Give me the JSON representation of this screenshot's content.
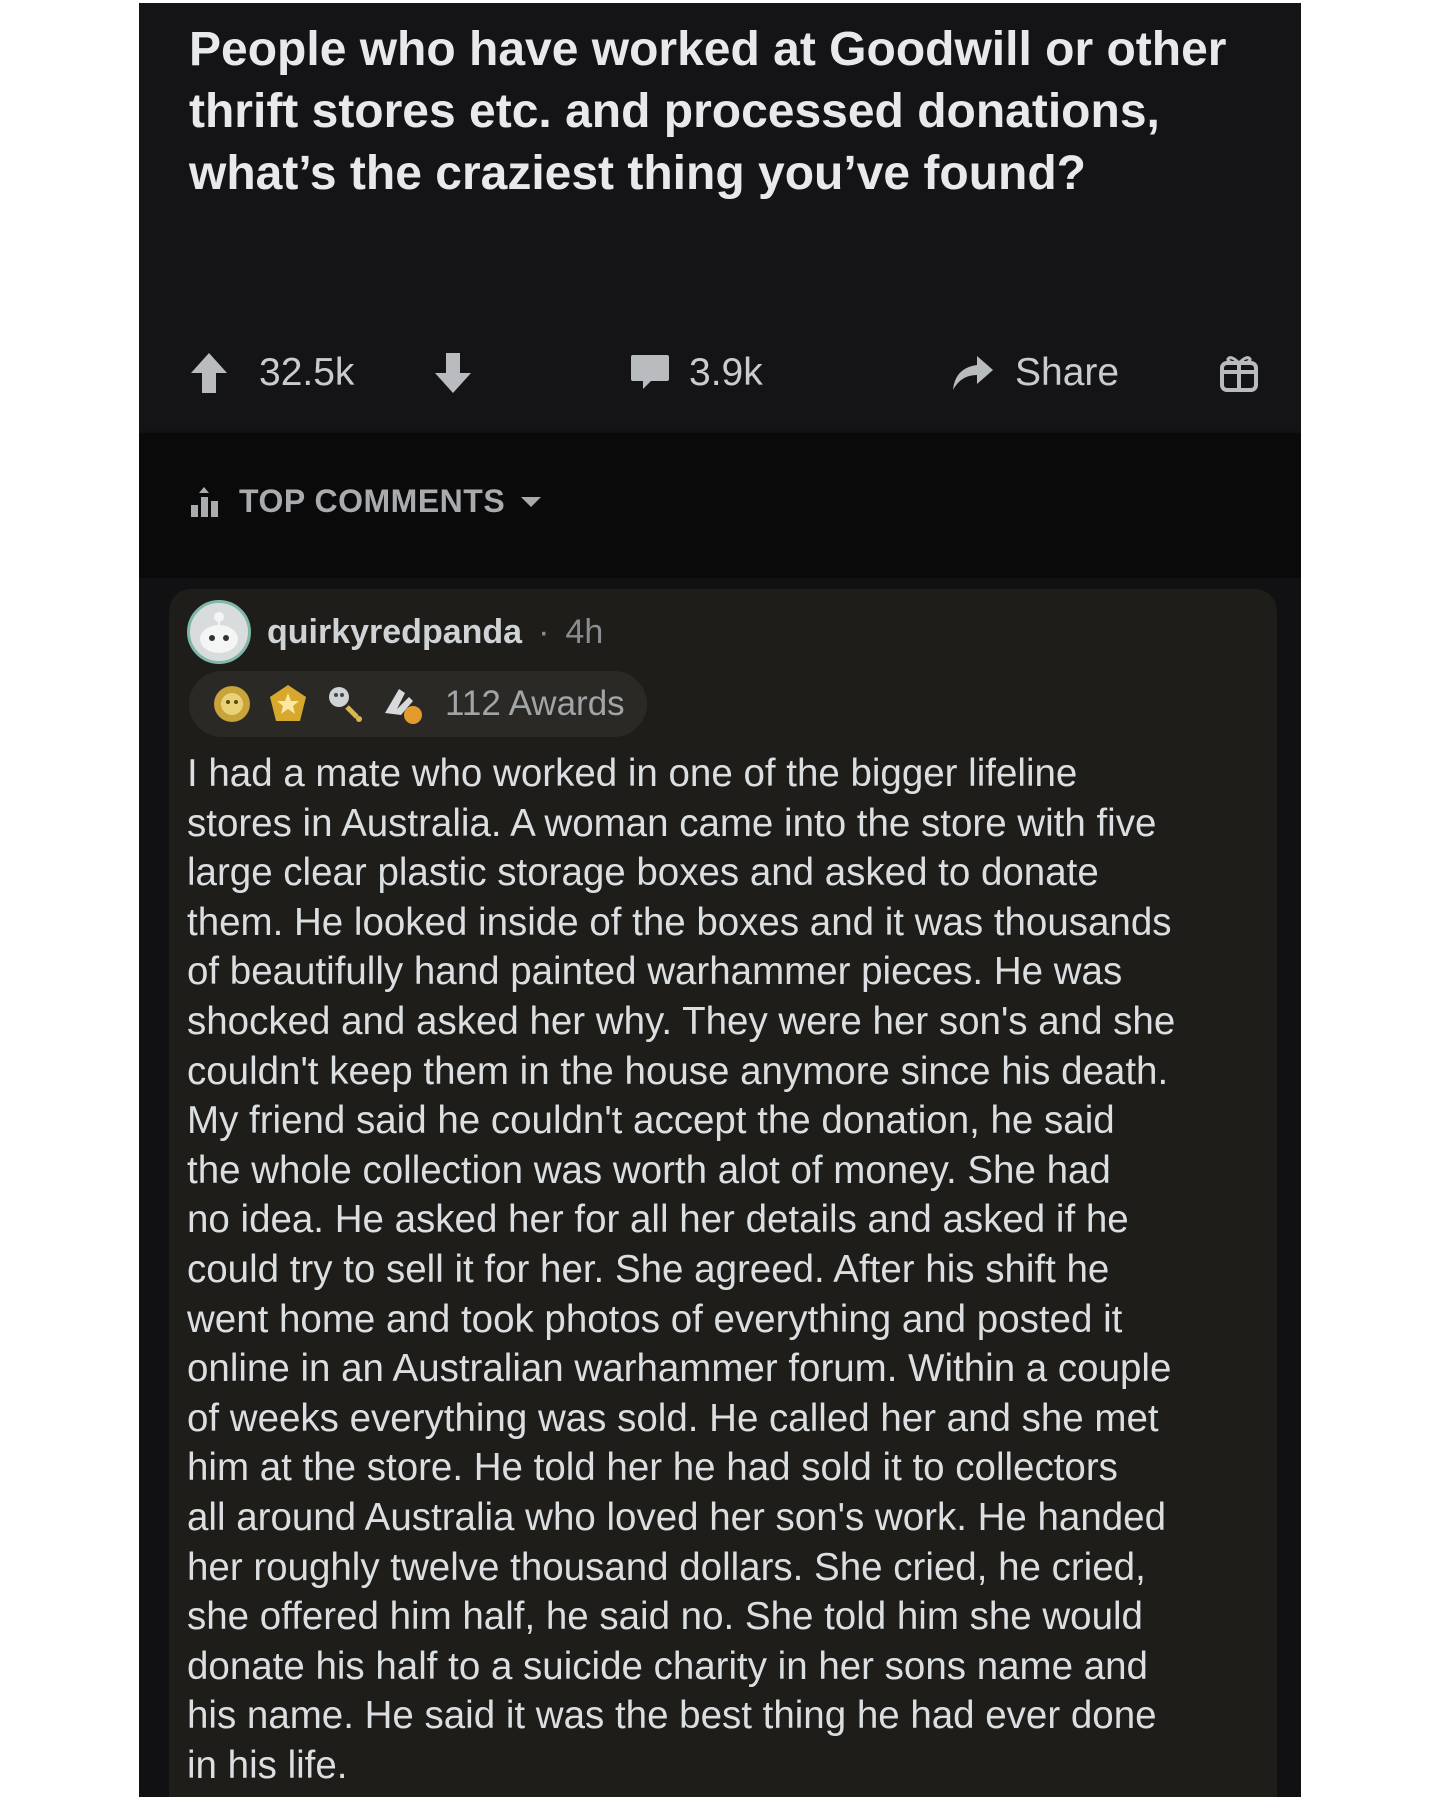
{
  "post": {
    "title": "People who have worked at Goodwill or other thrift stores etc. and processed donations, what’s the craziest thing you’ve found?",
    "votes": "32.5k",
    "comments": "3.9k",
    "share_label": "Share"
  },
  "sort": {
    "label": "TOP COMMENTS"
  },
  "comment": {
    "author": "quirkyredpanda",
    "separator": "·",
    "age": "4h",
    "awards_label": "112 Awards",
    "body": "I had a mate who worked in one of the bigger lifeline\nstores in Australia. A woman came into the store with five\nlarge clear plastic storage boxes and asked to donate\nthem. He looked inside of the boxes and it was thousands\nof beautifully hand painted warhammer pieces. He was\nshocked and asked her why. They were her son's and she\ncouldn't keep them in the house anymore since his death.\nMy friend said he couldn't accept the donation, he said\nthe whole collection was worth alot of money. She had\nno idea. He asked her for all her details and asked if he\ncould try to sell it for her. She agreed. After his shift he\nwent home and took photos of everything and posted it\nonline in an Australian warhammer forum. Within a couple\nof weeks everything was sold. He called her and she met\nhim at the store. He told her he had sold it to collectors\nall around Australia who loved her son's work. He handed\nher roughly twelve thousand dollars. She cried, he cried,\nshe offered him half,  he said no. She told him she would\ndonate his half to a suicide charity in her sons name and\nhis name. He said it was the best thing he had ever done\nin his life."
  },
  "icons": {
    "upvote": "arrow-up-icon",
    "downvote": "arrow-down-icon",
    "comments": "speech-bubble-icon",
    "share": "share-arrow-icon",
    "gift": "gift-icon",
    "sort": "bar-chart-icon",
    "dropdown": "caret-down-icon"
  },
  "colors": {
    "background": "#111113",
    "comment_card": "#1e1d1a",
    "text": "#d7dadc"
  }
}
